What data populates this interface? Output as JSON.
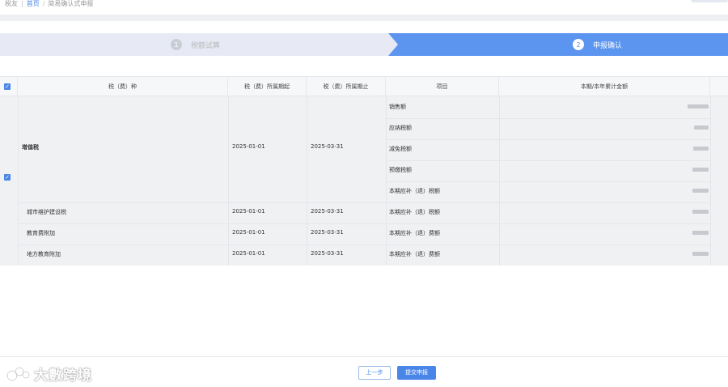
{
  "breadcrumb": {
    "root": "税友",
    "home": "首页",
    "current": "简易确认式申报"
  },
  "steps": [
    {
      "num": "1",
      "label": "税额试算",
      "active": false
    },
    {
      "num": "2",
      "label": "申报确认",
      "active": true
    }
  ],
  "table": {
    "headers": [
      "税（费）种",
      "税（费）所属期起",
      "税（费）所属期止",
      "项目",
      "本期/本年累计金额"
    ],
    "vat": {
      "name": "增值税",
      "start": "2025-01-01",
      "end": "2025-03-31",
      "items": [
        "销售额",
        "应纳税额",
        "减免税额",
        "预缴税额",
        "本期应补（退）税额"
      ]
    },
    "rows": [
      {
        "name": "城市维护建设税",
        "start": "2025-01-01",
        "end": "2025-03-31",
        "item": "本期应补（退）税额"
      },
      {
        "name": "教育费附加",
        "start": "2025-01-01",
        "end": "2025-03-31",
        "item": "本期应补（退）费额"
      },
      {
        "name": "地方教育附加",
        "start": "2025-01-01",
        "end": "2025-03-31",
        "item": "本期应补（退）费额"
      }
    ]
  },
  "footer": {
    "prev_label": "上一步",
    "submit_label": "提交申报"
  },
  "watermark": {
    "text": "大數跨境"
  },
  "colors": {
    "accent": "#4a86e8",
    "step_active": "#5b95f0",
    "step_inactive": "#e7eaf5"
  }
}
